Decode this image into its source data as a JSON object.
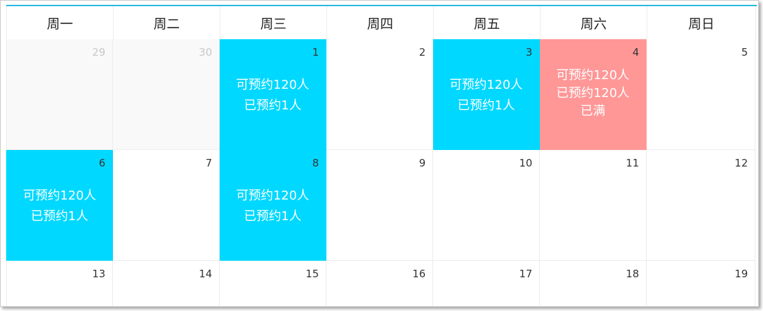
{
  "weekdays": [
    "周一",
    "周二",
    "周三",
    "周四",
    "周五",
    "周六",
    "周日"
  ],
  "weeks": [
    [
      {
        "day": "29",
        "state": "other"
      },
      {
        "day": "30",
        "state": "other"
      },
      {
        "day": "1",
        "state": "available",
        "lines": [
          "可预约120人",
          "已预约1人"
        ]
      },
      {
        "day": "2",
        "state": "normal"
      },
      {
        "day": "3",
        "state": "available",
        "lines": [
          "可预约120人",
          "已预约1人"
        ]
      },
      {
        "day": "4",
        "state": "full",
        "lines": [
          "可预约120人",
          "已预约120人",
          "已满"
        ]
      },
      {
        "day": "5",
        "state": "normal"
      }
    ],
    [
      {
        "day": "6",
        "state": "available",
        "lines": [
          "可预约120人",
          "已预约1人"
        ]
      },
      {
        "day": "7",
        "state": "normal"
      },
      {
        "day": "8",
        "state": "available",
        "lines": [
          "可预约120人",
          "已预约1人"
        ]
      },
      {
        "day": "9",
        "state": "normal"
      },
      {
        "day": "10",
        "state": "normal"
      },
      {
        "day": "11",
        "state": "normal"
      },
      {
        "day": "12",
        "state": "normal"
      }
    ],
    [
      {
        "day": "13",
        "state": "normal"
      },
      {
        "day": "14",
        "state": "normal"
      },
      {
        "day": "15",
        "state": "normal"
      },
      {
        "day": "16",
        "state": "normal"
      },
      {
        "day": "17",
        "state": "normal"
      },
      {
        "day": "18",
        "state": "normal"
      },
      {
        "day": "19",
        "state": "normal"
      }
    ]
  ],
  "colors": {
    "available": "#00d8ff",
    "full": "#ff9797",
    "accent_line": "#24b8e0"
  }
}
